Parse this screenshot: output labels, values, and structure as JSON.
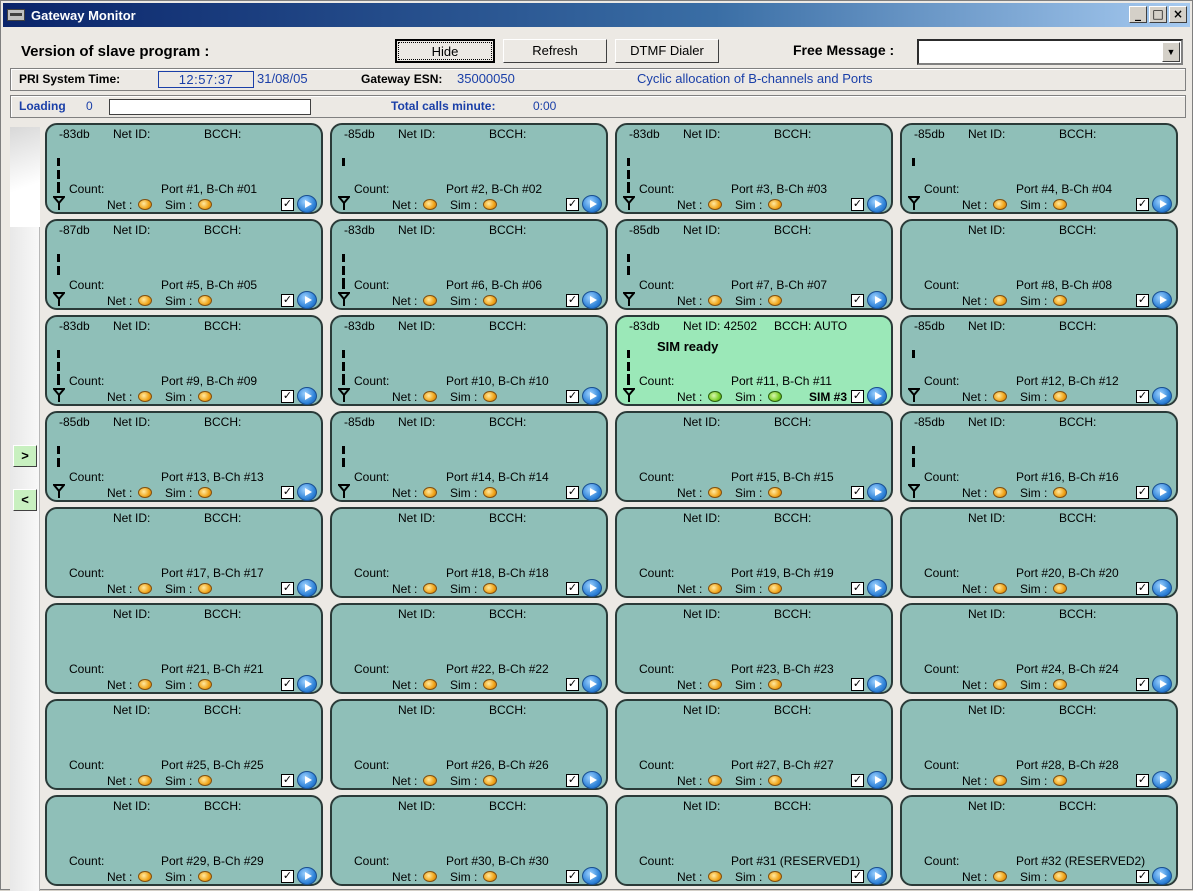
{
  "window": {
    "title": "Gateway Monitor",
    "controls": [
      "_",
      "□",
      "×"
    ]
  },
  "toolbar": {
    "version_label": "Version of slave program :",
    "hide_label": "Hide",
    "refresh_label": "Refresh",
    "dtmf_label": "DTMF Dialer",
    "free_message_label": "Free Message :",
    "free_message_value": ""
  },
  "status": {
    "pri_label": "PRI System Time:",
    "time": "12:57:37",
    "date": "31/08/05",
    "esn_label": "Gateway ESN:",
    "esn": "35000050",
    "allocation": "Cyclic allocation of B-channels and Ports",
    "loading_label": "Loading",
    "loading_value": "0",
    "loading_progress": 0,
    "total_calls_label": "Total calls minute:",
    "total_calls_value": "0:00"
  },
  "nav": {
    "next": ">",
    "prev": "<"
  },
  "labels": {
    "net_id": "Net ID:",
    "bcch": "BCCH:",
    "count": "Count:",
    "net": "Net :",
    "sim": "Sim :",
    "check": "✓"
  },
  "colors": {
    "card": "#8fbfb8",
    "active_card": "#9be8b8",
    "led_amber": "#f0a418",
    "led_green": "#7ccf28"
  },
  "ports": [
    {
      "db": "-83db",
      "port": "Port #1,  B-Ch #01",
      "signal": 3,
      "antenna": true
    },
    {
      "db": "-85db",
      "port": "Port #2,  B-Ch #02",
      "signal": 1,
      "antenna": true
    },
    {
      "db": "-83db",
      "port": "Port #3,  B-Ch #03",
      "signal": 3,
      "antenna": true
    },
    {
      "db": "-85db",
      "port": "Port #4,  B-Ch #04",
      "signal": 1,
      "antenna": true
    },
    {
      "db": "-87db",
      "port": "Port #5,  B-Ch #05",
      "signal": 2,
      "antenna": true
    },
    {
      "db": "-83db",
      "port": "Port #6,  B-Ch #06",
      "signal": 3,
      "antenna": true
    },
    {
      "db": "-85db",
      "port": "Port #7,  B-Ch #07",
      "signal": 2,
      "antenna": true
    },
    {
      "db": "",
      "port": "Port #8,  B-Ch #08",
      "signal": 0,
      "antenna": false
    },
    {
      "db": "-83db",
      "port": "Port #9,  B-Ch #09",
      "signal": 3,
      "antenna": true
    },
    {
      "db": "-83db",
      "port": "Port #10,  B-Ch #10",
      "signal": 3,
      "antenna": true
    },
    {
      "db": "-83db",
      "port": "Port #11,  B-Ch #11",
      "signal": 3,
      "antenna": true,
      "active": true,
      "net_id": "42502",
      "bcch": "AUTO",
      "msg": "SIM ready",
      "sim_no": "SIM #3"
    },
    {
      "db": "-85db",
      "port": "Port #12,  B-Ch #12",
      "signal": 1,
      "antenna": true
    },
    {
      "db": "-85db",
      "port": "Port #13,  B-Ch #13",
      "signal": 2,
      "antenna": true
    },
    {
      "db": "-85db",
      "port": "Port #14,  B-Ch #14",
      "signal": 2,
      "antenna": true
    },
    {
      "db": "",
      "port": "Port #15,  B-Ch #15",
      "signal": 0,
      "antenna": false
    },
    {
      "db": "-85db",
      "port": "Port #16,  B-Ch #16",
      "signal": 2,
      "antenna": true
    },
    {
      "db": "",
      "port": "Port #17,  B-Ch #17",
      "signal": 0,
      "antenna": false
    },
    {
      "db": "",
      "port": "Port #18,  B-Ch #18",
      "signal": 0,
      "antenna": false
    },
    {
      "db": "",
      "port": "Port #19,  B-Ch #19",
      "signal": 0,
      "antenna": false
    },
    {
      "db": "",
      "port": "Port #20,  B-Ch #20",
      "signal": 0,
      "antenna": false
    },
    {
      "db": "",
      "port": "Port #21,  B-Ch #21",
      "signal": 0,
      "antenna": false
    },
    {
      "db": "",
      "port": "Port #22,  B-Ch #22",
      "signal": 0,
      "antenna": false
    },
    {
      "db": "",
      "port": "Port #23,  B-Ch #23",
      "signal": 0,
      "antenna": false
    },
    {
      "db": "",
      "port": "Port #24,  B-Ch #24",
      "signal": 0,
      "antenna": false
    },
    {
      "db": "",
      "port": "Port #25,  B-Ch #25",
      "signal": 0,
      "antenna": false
    },
    {
      "db": "",
      "port": "Port #26,  B-Ch #26",
      "signal": 0,
      "antenna": false
    },
    {
      "db": "",
      "port": "Port #27,  B-Ch #27",
      "signal": 0,
      "antenna": false
    },
    {
      "db": "",
      "port": "Port #28,  B-Ch #28",
      "signal": 0,
      "antenna": false
    },
    {
      "db": "",
      "port": "Port #29,  B-Ch #29",
      "signal": 0,
      "antenna": false
    },
    {
      "db": "",
      "port": "Port #30,  B-Ch #30",
      "signal": 0,
      "antenna": false
    },
    {
      "db": "",
      "port": "Port #31 (RESERVED1)",
      "signal": 0,
      "antenna": false
    },
    {
      "db": "",
      "port": "Port #32 (RESERVED2)",
      "signal": 0,
      "antenna": false
    }
  ]
}
